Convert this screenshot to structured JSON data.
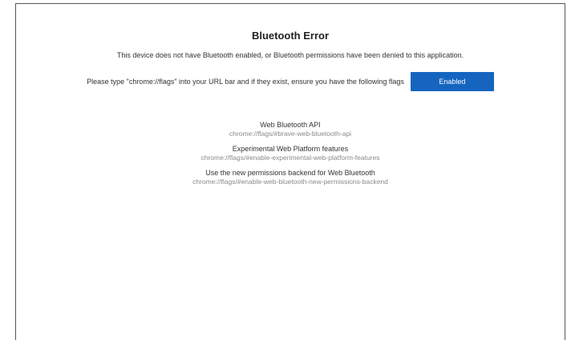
{
  "page": {
    "title": "Bluetooth Error",
    "message": "This device does not have Bluetooth enabled, or Bluetooth permissions have been denied to this application.",
    "instruction": "Please type \"chrome://flags\" into your URL bar and if they exist, ensure you have the following flags",
    "enabled_label": "Enabled"
  },
  "flags": [
    {
      "name": "Web Bluetooth API",
      "url": "chrome://flags/#brave-web-bluetooth-api"
    },
    {
      "name": "Experimental Web Platform features",
      "url": "chrome://flags/#enable-experimental-web-platform-features"
    },
    {
      "name": "Use the new permissions backend for Web Bluetooth",
      "url": "chrome://flags/#enable-web-bluetooth-new-permissions-backend"
    }
  ],
  "colors": {
    "button_bg": "#1565c0",
    "url_text": "#8a8a8a"
  }
}
